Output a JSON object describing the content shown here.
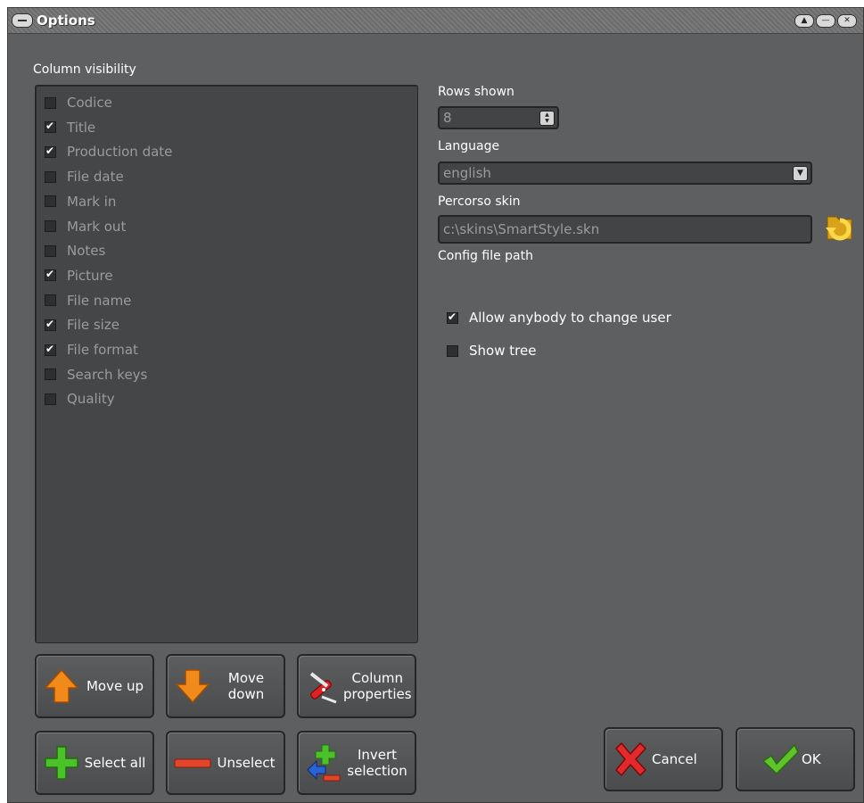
{
  "window": {
    "title": "Options",
    "controls": [
      "▲",
      "—",
      "✕"
    ]
  },
  "column_visibility": {
    "label": "Column visibility",
    "items": [
      {
        "label": "Codice",
        "checked": false
      },
      {
        "label": "Title",
        "checked": true
      },
      {
        "label": "Production date",
        "checked": true
      },
      {
        "label": "File date",
        "checked": false
      },
      {
        "label": "Mark in",
        "checked": false
      },
      {
        "label": "Mark out",
        "checked": false
      },
      {
        "label": "Notes",
        "checked": false
      },
      {
        "label": "Picture",
        "checked": true
      },
      {
        "label": "File name",
        "checked": false
      },
      {
        "label": "File size",
        "checked": true
      },
      {
        "label": "File format",
        "checked": true
      },
      {
        "label": "Search keys",
        "checked": false
      },
      {
        "label": "Quality",
        "checked": false
      }
    ]
  },
  "rows_shown": {
    "label": "Rows shown",
    "value": "8"
  },
  "language": {
    "label": "Language",
    "value": "english"
  },
  "skin": {
    "label": "Percorso skin",
    "value": "c:\\skins\\SmartStyle.skn"
  },
  "config": {
    "label": "Config file path"
  },
  "options": {
    "allow_change_user": {
      "label": "Allow anybody to change user",
      "checked": true
    },
    "show_tree": {
      "label": "Show tree",
      "checked": false
    }
  },
  "buttons": {
    "move_up": "Move up",
    "move_down": "Move down",
    "column_properties": "Column properties",
    "select_all": "Select all",
    "unselect": "Unselect",
    "invert_selection": "Invert selection",
    "cancel": "Cancel",
    "ok": "OK"
  },
  "icons": {
    "move_up": "orange-up-arrow-icon",
    "move_down": "orange-down-arrow-icon",
    "column_properties": "swiss-knife-icon",
    "select_all": "green-plus-icon",
    "unselect": "red-minus-icon",
    "invert_selection": "invert-arrows-icon",
    "cancel": "red-x-icon",
    "ok": "green-check-icon",
    "folder": "folder-refresh-icon"
  }
}
